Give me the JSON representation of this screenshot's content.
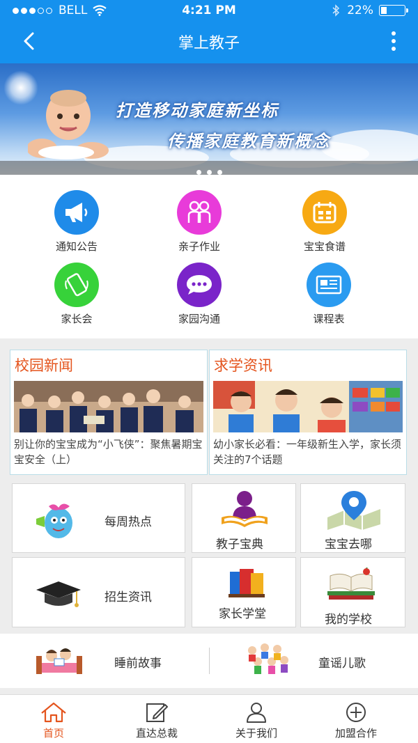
{
  "status_bar": {
    "carrier": "BELL",
    "time": "4:21 PM",
    "battery": "22%"
  },
  "header": {
    "title": "掌上教子"
  },
  "banner": {
    "line1": "打造移动家庭新坐标",
    "line2": "传播家庭教育新概念"
  },
  "grid": [
    {
      "label": "通知公告",
      "icon": "megaphone-icon",
      "color": "#1f8be9"
    },
    {
      "label": "亲子作业",
      "icon": "parent-child-icon",
      "color": "#e83bd9"
    },
    {
      "label": "宝宝食谱",
      "icon": "calendar-icon",
      "color": "#f7a913"
    },
    {
      "label": "家长会",
      "icon": "phone-icon",
      "color": "#37d23a"
    },
    {
      "label": "家园沟通",
      "icon": "chat-icon",
      "color": "#7a24c9"
    },
    {
      "label": "课程表",
      "icon": "newspaper-icon",
      "color": "#2a9bf0"
    }
  ],
  "news": [
    {
      "title": "校园新闻",
      "text": "别让你的宝宝成为“小飞侠”：聚焦暑期宝宝安全（上）"
    },
    {
      "title": "求学资讯",
      "text": "幼小家长必看：一年级新生入学，家长须关注的7个话题"
    }
  ],
  "tiles": {
    "weekly_hot": "每周热点",
    "parenting_guide": "教子宝典",
    "where_baby": "宝宝去哪",
    "admission": "招生资讯",
    "parent_school": "家长学堂",
    "my_school": "我的学校"
  },
  "row2": {
    "bedtime": "睡前故事",
    "songs": "童谣儿歌"
  },
  "tabbar": [
    {
      "label": "首页",
      "icon": "home-icon"
    },
    {
      "label": "直达总裁",
      "icon": "edit-icon"
    },
    {
      "label": "关于我们",
      "icon": "user-icon"
    },
    {
      "label": "加盟合作",
      "icon": "plus-circle-icon"
    }
  ],
  "colors": {
    "primary": "#1591ee",
    "accent": "#e4541d"
  }
}
